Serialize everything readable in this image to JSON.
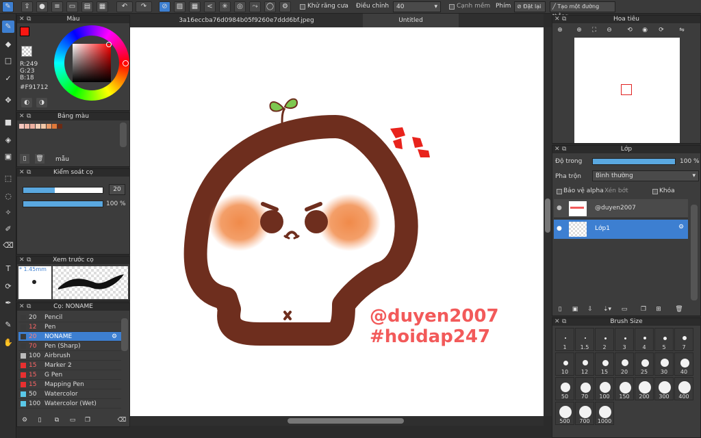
{
  "toolbar": {
    "antialias_label": "Khử răng cưa",
    "adjust_label": "Điều chỉnh",
    "adjust_value": "40",
    "soft_edge_label": "Cạnh mềm",
    "key_label": "Phím",
    "reset_label": "Đặt lại",
    "straight_line_label": "Tạo một đường thẳng"
  },
  "tabs": [
    "3a16eccba76d0984b05f9260e7ddd6bf.jpeg",
    "Untitled"
  ],
  "color_panel": {
    "title": "Màu",
    "r": "R:249",
    "g": "G:23",
    "b": "B:18",
    "hex": "#F91712",
    "primary_color": "#f91712"
  },
  "palette_panel": {
    "title": "Bảng màu",
    "name": "mẫu",
    "colors": [
      "#f5c8c0",
      "#f0b8a8",
      "#eeb0a0",
      "#f5d0b8",
      "#f2c8a8",
      "#e89a6a",
      "#e07838",
      "#6b2a14"
    ]
  },
  "brush_control": {
    "title": "Kiểm soát cọ",
    "size_value": "20",
    "opacity_value": "100 %",
    "size_fraction": 0.4,
    "opacity_fraction": 1.0
  },
  "brush_preview": {
    "title": "Xem trước cọ",
    "size_text": "* 1.45mm"
  },
  "brush_list": {
    "title": "Cọ: NONAME",
    "items": [
      {
        "size": "20",
        "name": "Pencil",
        "color": "#3a3a3a"
      },
      {
        "size": "12",
        "name": "Pen",
        "color": "#3a3a3a"
      },
      {
        "size": "20",
        "name": "NONAME",
        "color": "#3a3a3a"
      },
      {
        "size": "70",
        "name": "Pen (Sharp)",
        "color": "#3a3a3a"
      },
      {
        "size": "100",
        "name": "Airbrush",
        "color": "#bbbbbb"
      },
      {
        "size": "15",
        "name": "Marker 2",
        "color": "#e83030"
      },
      {
        "size": "15",
        "name": "G Pen",
        "color": "#e83030"
      },
      {
        "size": "15",
        "name": "Mapping Pen",
        "color": "#e83030"
      },
      {
        "size": "50",
        "name": "Watercolor",
        "color": "#5ac8e8"
      },
      {
        "size": "100",
        "name": "Watercolor (Wet)",
        "color": "#5ac8e8"
      }
    ]
  },
  "navigator": {
    "title": "Hoa tiêu"
  },
  "layers": {
    "title": "Lớp",
    "opacity_label": "Độ trong",
    "opacity_value": "100 %",
    "opacity_fraction": 1.0,
    "blend_label": "Pha trộn",
    "blend_value": "Bình thường",
    "protect_alpha": "Bảo vệ alpha",
    "clipping": "Xén bớt",
    "lock": "Khóa",
    "items": [
      {
        "name": "@duyen2007"
      },
      {
        "name": "Lớp1"
      }
    ]
  },
  "brush_size": {
    "title": "Brush Size",
    "sizes": [
      "1",
      "1.5",
      "2",
      "3",
      "4",
      "5",
      "7",
      "10",
      "12",
      "15",
      "20",
      "25",
      "30",
      "40",
      "50",
      "70",
      "100",
      "150",
      "200",
      "300",
      "400",
      "500",
      "700",
      "1000"
    ]
  },
  "artwork": {
    "text1": "@duyen2007",
    "text2": "#hoidap247",
    "text_color": "#f25a5a",
    "outline_color": "#6e2e1e",
    "blush_color": "#f08a4a"
  }
}
